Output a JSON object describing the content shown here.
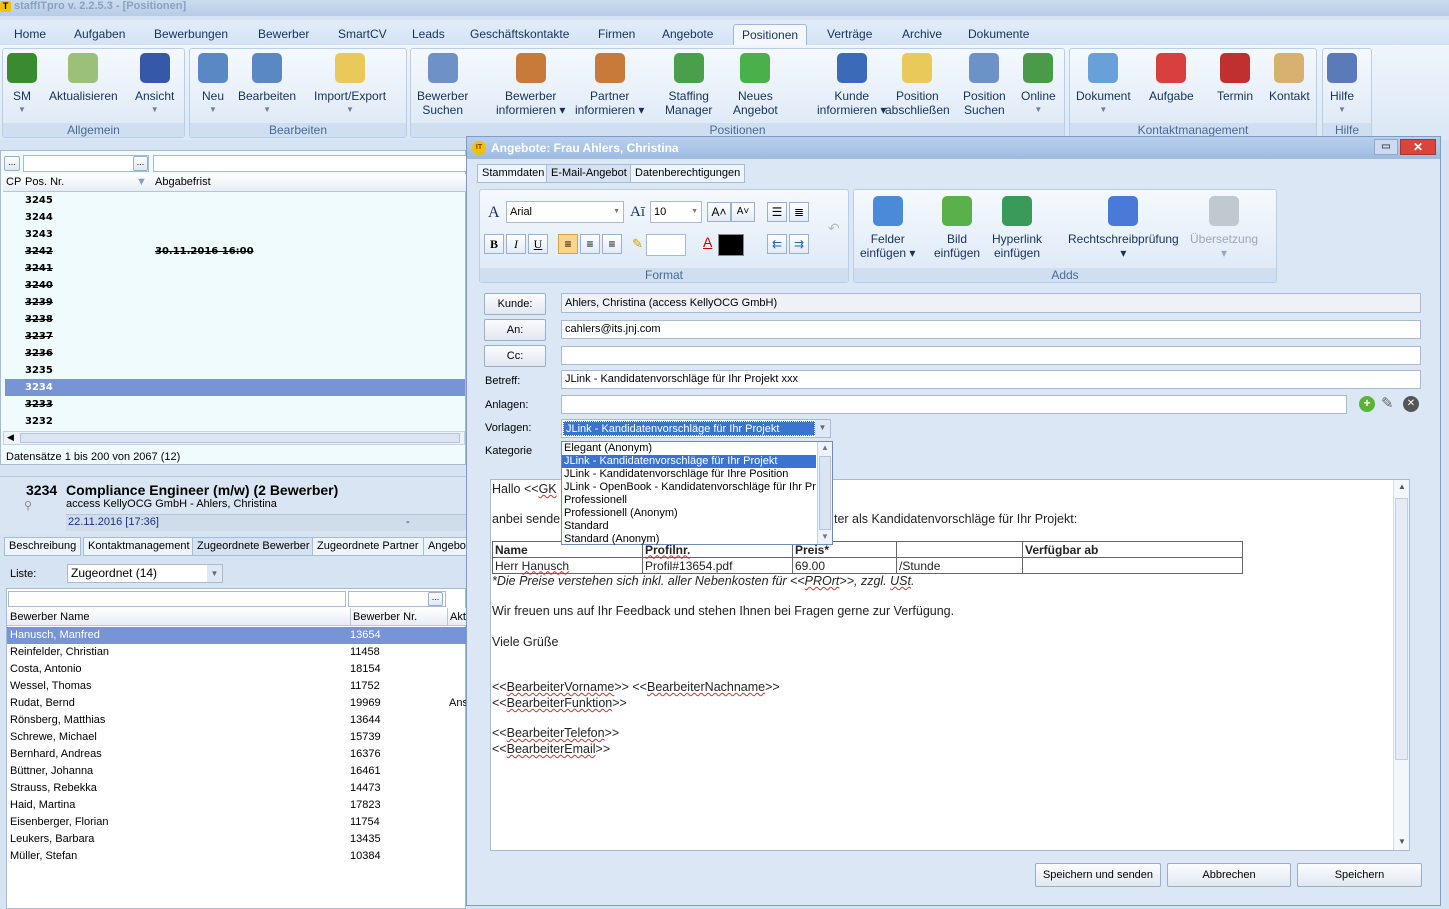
{
  "app": {
    "title": "staffITpro v. 2.2.5.3 - [Positionen]",
    "logo": "T"
  },
  "menu": [
    "Home",
    "Aufgaben",
    "Bewerbungen",
    "Bewerber",
    "SmartCV",
    "Leads",
    "Geschäftskontakte",
    "Firmen",
    "Angebote",
    "Positionen",
    "Verträge",
    "Archive",
    "Dokumente"
  ],
  "menu_active": "Positionen",
  "ribbon": {
    "groups": [
      {
        "label": "Allgemein",
        "buttons": [
          {
            "l1": "SM",
            "icon": "user-icon",
            "dd": true
          },
          {
            "l1": "Aktualisieren",
            "icon": "refresh-icon"
          },
          {
            "l1": "Ansicht",
            "icon": "view-gear-icon",
            "dd": true
          }
        ]
      },
      {
        "label": "Bearbeiten",
        "buttons": [
          {
            "l1": "Neu",
            "icon": "new-card-icon",
            "dd": true
          },
          {
            "l1": "Bearbeiten",
            "icon": "edit-card-icon",
            "dd": true
          },
          {
            "l1": "Import/Export",
            "icon": "folder-recycle-icon",
            "dd": true
          }
        ]
      },
      {
        "label": "Positionen",
        "buttons": [
          {
            "l1": "Bewerber",
            "l2": "Suchen",
            "icon": "search-card-icon"
          },
          {
            "l1": "Bewerber",
            "l2": "informieren ▾",
            "icon": "user-info-icon"
          },
          {
            "l1": "Partner",
            "l2": "informieren ▾",
            "icon": "users-info-icon"
          },
          {
            "l1": "Staffing",
            "l2": "Manager",
            "icon": "check-card-icon"
          },
          {
            "l1": "Neues",
            "l2": "Angebot",
            "icon": "new-offer-icon"
          },
          {
            "l1": "Kunde",
            "l2": "informieren ▾",
            "icon": "customer-info-icon"
          },
          {
            "l1": "Position",
            "l2": "abschließen",
            "icon": "folder-lock-icon"
          },
          {
            "l1": "Position",
            "l2": "Suchen",
            "icon": "search-card-icon"
          },
          {
            "l1": "Online",
            "icon": "globe-icon",
            "dd": true
          }
        ]
      },
      {
        "label": "Kontaktmanagement",
        "buttons": [
          {
            "l1": "Dokument",
            "icon": "document-icon",
            "dd": true
          },
          {
            "l1": "Aufgabe",
            "icon": "task-icon"
          },
          {
            "l1": "Termin",
            "icon": "calendar-icon"
          },
          {
            "l1": "Kontakt",
            "icon": "contact-icon"
          }
        ]
      },
      {
        "label": "Hilfe",
        "buttons": [
          {
            "l1": "Hilfe",
            "icon": "help-book-icon",
            "dd": true
          }
        ]
      }
    ]
  },
  "positions": {
    "filter_button": "...",
    "columns": [
      "CP",
      "Pos. Nr.",
      "Abgabefrist"
    ],
    "rows": [
      {
        "nr": "3245",
        "date": "",
        "strike": false
      },
      {
        "nr": "3244",
        "date": "",
        "strike": false
      },
      {
        "nr": "3243",
        "date": "",
        "strike": false
      },
      {
        "nr": "3242",
        "date": "30.11.2016 16:00",
        "strike": true
      },
      {
        "nr": "3241",
        "date": "",
        "strike": true
      },
      {
        "nr": "3240",
        "date": "",
        "strike": true
      },
      {
        "nr": "3239",
        "date": "",
        "strike": true
      },
      {
        "nr": "3238",
        "date": "",
        "strike": true
      },
      {
        "nr": "3237",
        "date": "",
        "strike": true
      },
      {
        "nr": "3236",
        "date": "",
        "strike": true
      },
      {
        "nr": "3235",
        "date": "",
        "strike": false
      },
      {
        "nr": "3234",
        "date": "",
        "strike": false,
        "selected": true
      },
      {
        "nr": "3233",
        "date": "",
        "strike": true
      },
      {
        "nr": "3232",
        "date": "",
        "strike": false
      }
    ],
    "status": "Datensätze 1 bis 200 von 2067 (12)"
  },
  "detail": {
    "nr": "3234",
    "title": "Compliance Engineer (m/w) (2 Bewerber)",
    "sub": "access KellyOCG GmbH - Ahlers, Christina",
    "date": "22.11.2016 [17:36]",
    "dash": "-",
    "tabs": [
      "Beschreibung",
      "Kontaktmanagement",
      "Zugeordnete Bewerber",
      "Zugeordnete Partner",
      "Angebo"
    ],
    "active_tab": "Zugeordnete Bewerber",
    "liste_label": "Liste:",
    "liste_value": "Zugeordnet (14)",
    "columns": [
      "Bewerber Name",
      "Bewerber Nr.",
      "Akt"
    ],
    "rows": [
      {
        "name": "Hanusch, Manfred",
        "nr": "13654",
        "akt": "",
        "selected": true
      },
      {
        "name": "Reinfelder, Christian",
        "nr": "11458",
        "akt": ""
      },
      {
        "name": "Costa, Antonio",
        "nr": "18154",
        "akt": ""
      },
      {
        "name": "Wessel, Thomas",
        "nr": "11752",
        "akt": ""
      },
      {
        "name": "Rudat, Bernd",
        "nr": "19969",
        "akt": "Ans"
      },
      {
        "name": "Rönsberg, Matthias",
        "nr": "13644",
        "akt": ""
      },
      {
        "name": "Schrewe, Michael",
        "nr": "15739",
        "akt": ""
      },
      {
        "name": "Bernhard, Andreas",
        "nr": "16376",
        "akt": ""
      },
      {
        "name": "Büttner, Johanna",
        "nr": "16461",
        "akt": ""
      },
      {
        "name": "Strauss, Rebekka",
        "nr": "14473",
        "akt": ""
      },
      {
        "name": "Haid, Martina",
        "nr": "17823",
        "akt": ""
      },
      {
        "name": "Eisenberger, Florian",
        "nr": "11754",
        "akt": ""
      },
      {
        "name": "Leukers, Barbara",
        "nr": "13435",
        "akt": ""
      },
      {
        "name": "Müller, Stefan",
        "nr": "10384",
        "akt": ""
      }
    ]
  },
  "dialog": {
    "logo": "IT",
    "title": "Angebote: Frau Ahlers, Christina",
    "tabs": [
      "Stammdaten",
      "E-Mail-Angebot",
      "Datenberechtigungen"
    ],
    "active_tab": "E-Mail-Angebot",
    "format": {
      "font": "Arial",
      "size": "10",
      "group_label": "Format"
    },
    "adds": {
      "group_label": "Adds",
      "buttons": [
        {
          "l1": "Felder",
          "l2": "einfügen ▾"
        },
        {
          "l1": "Bild",
          "l2": "einfügen"
        },
        {
          "l1": "Hyperlink",
          "l2": "einfügen"
        },
        {
          "l1": "Rechtschreibprüfung",
          "l2": "▾"
        },
        {
          "l1": "Übersetzung",
          "l2": "▾",
          "disabled": true
        }
      ]
    },
    "fields": {
      "kunde_btn": "Kunde:",
      "kunde": "Ahlers, Christina (access KellyOCG GmbH)",
      "an_btn": "An:",
      "an": "cahlers@its.jnj.com",
      "cc_btn": "Cc:",
      "cc": "",
      "betreff_label": "Betreff:",
      "betreff": "JLink - Kandidatenvorschläge für Ihr Projekt xxx",
      "anlagen_label": "Anlagen:",
      "anlagen": "",
      "vorlagen_label": "Vorlagen:",
      "vorlagen": "JLink - Kandidatenvorschläge für Ihr Projekt",
      "kategorie_label": "Kategorie"
    },
    "vorlagen_options": [
      "Elegant (Anonym)",
      "JLink - Kandidatenvorschläge für Ihr Projekt",
      "JLink - Kandidatenvorschläge für Ihre Position",
      "JLink - OpenBook - Kandidatenvorschläge für Ihr Proj",
      "Professionell",
      "Professionell (Anonym)",
      "Standard",
      "Standard (Anonym)"
    ],
    "vorlagen_selected_index": 1,
    "body": {
      "greeting_a": "Hallo <<",
      "greeting_b": "GK",
      "intro_a": "anbei sende",
      "intro_b": "ter als Kandidatenvorschläge für Ihr Projekt:",
      "table_headers": [
        "Name",
        "Profilnr.",
        "Preis*",
        "",
        "Verfügbar ab"
      ],
      "table_row": {
        "a": "Herr ",
        "b": "Hanusch",
        "profil": "Profil#13654.pdf",
        "preis": "69.00",
        "unit": "/Stunde",
        "ab": ""
      },
      "note_a": "*Die Preise verstehen sich inkl. aller Nebenkosten für <<",
      "note_b": "PROrt",
      "note_c": ">>, zzgl. ",
      "note_d": "USt",
      "feedback": "Wir freuen uns auf Ihr Feedback und stehen Ihnen bei Fragen gerne zur Verfügung.",
      "regards": "Viele Grüße",
      "ph1": "BearbeiterVorname",
      "ph2": "BearbeiterNachname",
      "ph3": "BearbeiterFunktion",
      "ph4": "BearbeiterTelefon",
      "ph5": "BearbeiterEmail"
    },
    "buttons": {
      "send": "Speichern und senden",
      "cancel": "Abbrechen",
      "save": "Speichern"
    }
  },
  "colors": {
    "selection": "#7694d6",
    "dropdown_selection": "#3a73d0",
    "close": "#d9453b"
  }
}
